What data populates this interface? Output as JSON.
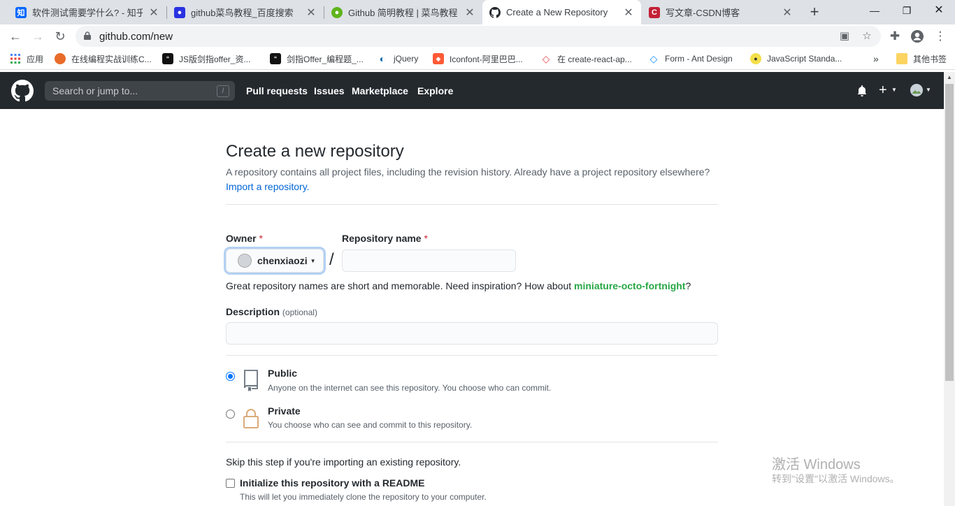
{
  "browser": {
    "tabs": [
      {
        "title": "软件测试需要学什么? - 知乎",
        "favicon": "zhihu-icon",
        "color": "#0066ff",
        "glyph": "知"
      },
      {
        "title": "github菜鸟教程_百度搜索",
        "favicon": "baidu-paw-icon",
        "color": "#2932e1",
        "glyph": "🐾"
      },
      {
        "title": "Github 简明教程 | 菜鸟教程",
        "favicon": "runoob-icon",
        "color": "#5fb41d",
        "glyph": "●"
      },
      {
        "title": "Create a New Repository",
        "favicon": "github-icon",
        "color": "#24292e",
        "glyph": "●",
        "active": true
      },
      {
        "title": "写文章-CSDN博客",
        "favicon": "csdn-icon",
        "color": "#c32136",
        "glyph": "C"
      }
    ],
    "url": "github.com/new"
  },
  "bookmarks": [
    {
      "label": "应用",
      "icon": "apps-grid-icon",
      "color": "#4285f4"
    },
    {
      "label": "在线编程实战训练C...",
      "icon": "bookmark-favicon",
      "color": "#e96c2a"
    },
    {
      "label": "JS版剑指offer_资...",
      "icon": "bookmark-favicon",
      "color": "#111111"
    },
    {
      "label": "剑指Offer_编程题_...",
      "icon": "bookmark-favicon",
      "color": "#111111"
    },
    {
      "label": "jQuery",
      "icon": "jquery-icon",
      "color": "#0769ad"
    },
    {
      "label": "Iconfont-阿里巴巴...",
      "icon": "iconfont-icon",
      "color": "#ff5a36"
    },
    {
      "label": "在 create-react-ap...",
      "icon": "diamond-icon",
      "color": "#e14b4b"
    },
    {
      "label": "Form - Ant Design",
      "icon": "antd-icon",
      "color": "#1890ff"
    },
    {
      "label": "JavaScript Standa...",
      "icon": "js-standard-icon",
      "color": "#f3df49"
    }
  ],
  "bookmarks_more": "»",
  "other_bookmarks": "其他书签",
  "github": {
    "search_placeholder": "Search or jump to...",
    "search_key": "/",
    "nav": [
      "Pull requests",
      "Issues",
      "Marketplace",
      "Explore"
    ]
  },
  "form": {
    "title": "Create a new repository",
    "subtitle": "A repository contains all project files, including the revision history. Already have a project repository elsewhere?",
    "import_link": "Import a repository.",
    "owner_label": "Owner",
    "required_mark": "*",
    "owner_name": "chenxiaozi",
    "separator": "/",
    "repo_label": "Repository name",
    "repo_value": "",
    "hint_prefix": "Great repository names are short and memorable. Need inspiration? How about ",
    "hint_suggestion": "miniature-octo-fortnight",
    "hint_suffix": "?",
    "desc_label": "Description",
    "desc_optional": "(optional)",
    "desc_value": "",
    "public_title": "Public",
    "public_desc": "Anyone on the internet can see this repository. You choose who can commit.",
    "private_title": "Private",
    "private_desc": "You choose who can see and commit to this repository.",
    "selected_visibility": "Public",
    "skip_text": "Skip this step if you're importing an existing repository.",
    "readme_label": "Initialize this repository with a README",
    "readme_desc": "This will let you immediately clone the repository to your computer.",
    "readme_checked": false
  },
  "watermark": {
    "line1": "激活 Windows",
    "line2": "转到\"设置\"以激活 Windows。"
  }
}
